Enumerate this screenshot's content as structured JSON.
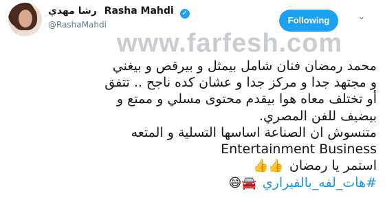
{
  "author": {
    "name_arabic": "رشا مهدي",
    "name_latin": "Rasha Mahdi",
    "handle": "@RashaMahdi",
    "verified": true
  },
  "actions": {
    "follow_label": "Following",
    "menu_icon": "chevron-down-icon"
  },
  "watermark": "www.farfesh.com",
  "tweet": {
    "lines": [
      "محمد رمضان فنان شامل بيمثل و بيرقص و بيغني",
      "و مجتهد جدا و مركز جدا و عشان كده ناجح .. تتفق",
      "أو تختلف معاه هوا بيقدم محتوى مسلي و ممتع و",
      "بيضيف للفن المصري.",
      "متنسوش ان الصناعة اساسها التسلية و المتعه",
      "Entertainment Business",
      "استمر يا رمضان"
    ],
    "emoji_line": "👍👍",
    "hashtag": "#هات_لفه_بالفيراري",
    "hashtag_emojis": "🚘😄"
  },
  "colors": {
    "follow_bg": "#1da1f2",
    "hashtag": "#1b95e0",
    "handle": "#657786"
  }
}
